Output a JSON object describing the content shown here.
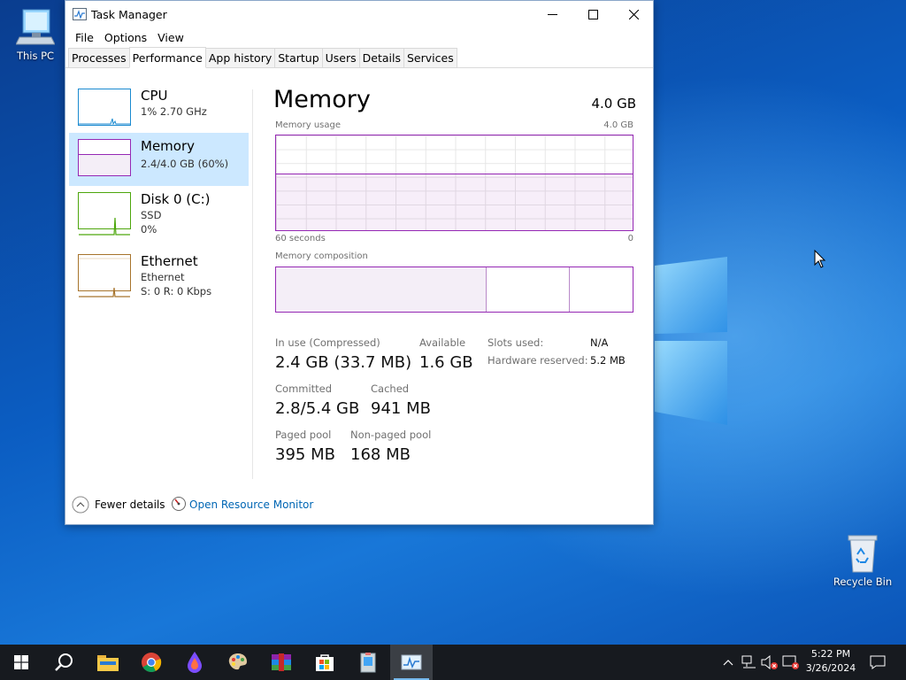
{
  "desktop": {
    "icons": [
      {
        "label": "This PC"
      },
      {
        "label": "Recycle Bin"
      }
    ]
  },
  "window": {
    "title": "Task Manager",
    "menu": [
      "File",
      "Options",
      "View"
    ],
    "tabs": [
      "Processes",
      "Performance",
      "App history",
      "Startup",
      "Users",
      "Details",
      "Services"
    ],
    "active_tab": "Performance"
  },
  "resources": [
    {
      "name": "CPU",
      "sub1": "1% 2.70 GHz",
      "sub2": ""
    },
    {
      "name": "Memory",
      "sub1": "2.4/4.0 GB (60%)",
      "sub2": ""
    },
    {
      "name": "Disk 0 (C:)",
      "sub1": "SSD",
      "sub2": "0%"
    },
    {
      "name": "Ethernet",
      "sub1": "Ethernet",
      "sub2": "S: 0 R: 0 Kbps"
    }
  ],
  "memory": {
    "title": "Memory",
    "total": "4.0 GB",
    "usage_label": "Memory usage",
    "usage_max": "4.0 GB",
    "time_label": "60 seconds",
    "time_min": "0",
    "composition_label": "Memory composition",
    "usage_fraction": 0.6,
    "composition": {
      "in_use_fraction": 0.59,
      "standby_fraction": 0.235,
      "free_fraction": 0.175
    },
    "stats": {
      "in_use_label": "In use (Compressed)",
      "in_use_value": "2.4 GB (33.7 MB)",
      "available_label": "Available",
      "available_value": "1.6 GB",
      "slots_label": "Slots used:",
      "slots_value": "N/A",
      "hw_label": "Hardware reserved:",
      "hw_value": "5.2 MB",
      "committed_label": "Committed",
      "committed_value": "2.8/5.4 GB",
      "cached_label": "Cached",
      "cached_value": "941 MB",
      "paged_label": "Paged pool",
      "paged_value": "395 MB",
      "nonpaged_label": "Non-paged pool",
      "nonpaged_value": "168 MB"
    }
  },
  "footer": {
    "fewer_details": "Fewer details",
    "open_rm": "Open Resource Monitor"
  },
  "taskbar": {
    "apps": [
      "start-icon",
      "search-icon",
      "file-explorer-icon",
      "chrome-icon",
      "paint-drop-icon",
      "paint-palette-icon",
      "winrar-icon",
      "store-icon",
      "notepad-icon",
      "task-manager-icon"
    ],
    "time": "5:22 PM",
    "date": "3/26/2024"
  },
  "colors": {
    "memory_accent": "#9528b4",
    "cpu_accent": "#1a8ad0",
    "disk_accent": "#4da60c",
    "net_accent": "#a7742c",
    "selected_bg": "#cce8ff",
    "link": "#0066b4"
  }
}
